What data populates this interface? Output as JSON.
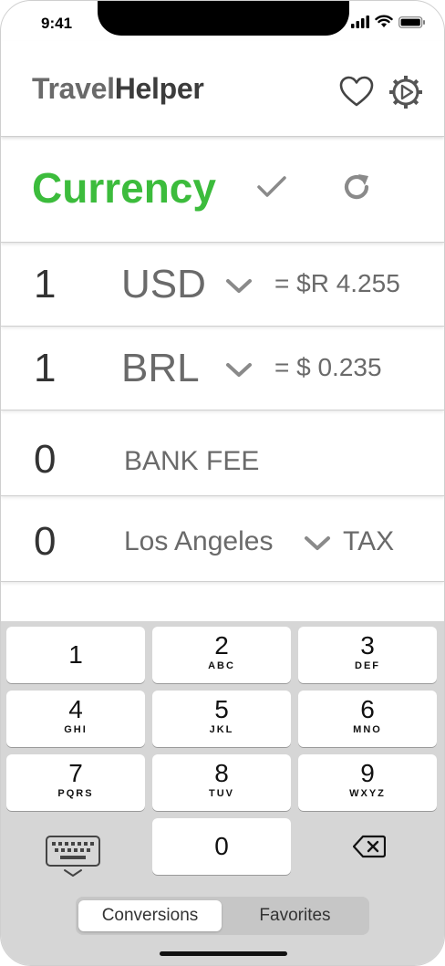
{
  "status_bar": {
    "time": "9:41"
  },
  "header": {
    "logo_light": "Travel",
    "logo_bold": "Helper",
    "favorite_icon": "heart-icon",
    "settings_icon": "gear-icon"
  },
  "currency_section": {
    "title": "Currency",
    "title_color": "#3cbc3c",
    "confirm_icon": "check-icon",
    "refresh_icon": "refresh-icon"
  },
  "conversions": [
    {
      "amount": "1",
      "currency": "USD",
      "rate": "= $R 4.255"
    },
    {
      "amount": "1",
      "currency": "BRL",
      "rate": "= $ 0.235"
    }
  ],
  "bank_fee": {
    "amount": "0",
    "label": "BANK FEE"
  },
  "tax": {
    "amount": "0",
    "location": "Los Angeles",
    "label": "TAX"
  },
  "keypad": {
    "keys": [
      {
        "digit": "1",
        "letters": ""
      },
      {
        "digit": "2",
        "letters": "ABC"
      },
      {
        "digit": "3",
        "letters": "DEF"
      },
      {
        "digit": "4",
        "letters": "GHI"
      },
      {
        "digit": "5",
        "letters": "JKL"
      },
      {
        "digit": "6",
        "letters": "MNO"
      },
      {
        "digit": "7",
        "letters": "PQRS"
      },
      {
        "digit": "8",
        "letters": "TUV"
      },
      {
        "digit": "9",
        "letters": "WXYZ"
      },
      {
        "digit": "0",
        "letters": ""
      }
    ],
    "hide_keyboard_icon": "keyboard-icon",
    "delete_icon": "backspace-icon"
  },
  "tabs": [
    {
      "label": "Conversions",
      "active": true
    },
    {
      "label": "Favorites",
      "active": false
    }
  ]
}
